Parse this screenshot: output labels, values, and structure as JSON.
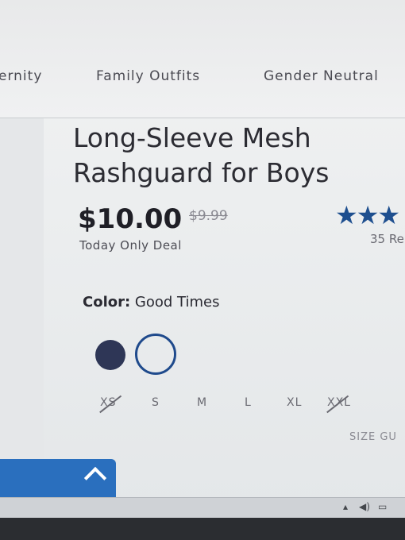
{
  "nav": {
    "items": [
      "ernity",
      "Family Outfits",
      "Gender Neutral"
    ]
  },
  "product": {
    "title_line1": "Long-Sleeve Mesh",
    "title_line2": "Rashguard for Boys",
    "price": "$10.00",
    "old_price": "$9.99",
    "deal_label": "Today Only Deal",
    "rating_stars": "★★★",
    "reviews_text": "35 Re"
  },
  "color": {
    "label": "Color:",
    "value": "Good Times",
    "swatches": [
      "navy-filled",
      "selected-outline"
    ]
  },
  "sizes": [
    {
      "label": "XS",
      "available": false
    },
    {
      "label": "S",
      "available": true
    },
    {
      "label": "M",
      "available": true
    },
    {
      "label": "L",
      "available": true
    },
    {
      "label": "XL",
      "available": true
    },
    {
      "label": "XXL",
      "available": false
    }
  ],
  "size_guide_label": "SIZE GU",
  "taskbar": {
    "icons": [
      "chevron-up-icon",
      "speaker-icon",
      "network-icon"
    ]
  },
  "colors": {
    "accent": "#1e4f8f",
    "swatch_navy": "#2e3656",
    "back_to_top": "#2a6fbe"
  }
}
